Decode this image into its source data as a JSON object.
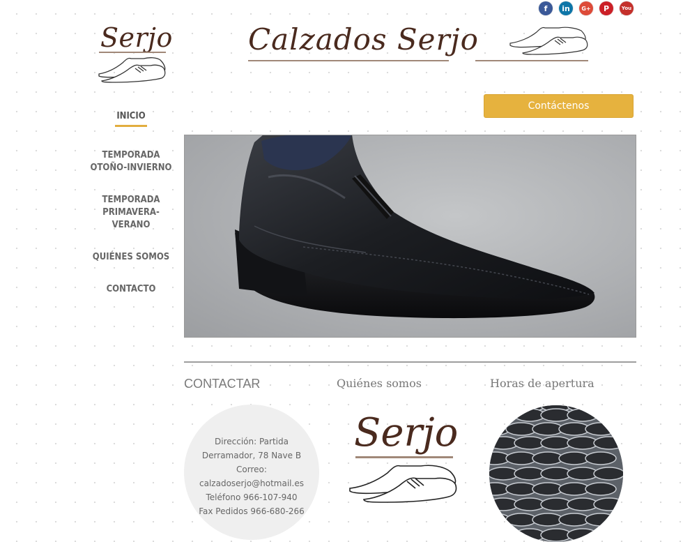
{
  "social": [
    "facebook-icon",
    "linkedin-icon",
    "google-plus-icon",
    "pinterest-icon",
    "youtube-icon"
  ],
  "social_labels": {
    "facebook": "f",
    "linkedin": "in",
    "googleplus": "G+",
    "pinterest": "P",
    "youtube": "You"
  },
  "brand": {
    "small_logo": "Serjo",
    "big_logo": "Calzados Serjo",
    "color": "#4a2a1e"
  },
  "nav": {
    "items": [
      {
        "label": "INICIO",
        "active": true
      },
      {
        "label": "TEMPORADA OTOÑO-INVIERNO"
      },
      {
        "label": "TEMPORADA PRIMAVERA-VERANO"
      },
      {
        "label": "QUIÉNES SOMOS"
      },
      {
        "label": "CONTACTO"
      }
    ],
    "l1a": "INICIO",
    "l2a": "TEMPORADA",
    "l2b": "OTOÑO-INVIERNO",
    "l3a": "TEMPORADA",
    "l3b": "PRIMAVERA-",
    "l3c": "VERANO",
    "l4a": "QUIÉNES SOMOS",
    "l5a": "CONTACTO"
  },
  "contact_button": "Contáctenos",
  "accent": "#e6b23e",
  "sections": {
    "contact_title": "CONTACTAR",
    "about_title": "Quiénes somos",
    "hours_title": "Horas de apertura"
  },
  "contact": {
    "line1": "Dirección: Partida",
    "line2": "Derramador, 78 Nave B",
    "line3": "Correo:",
    "line4": "calzadoserjo@hotmail.es",
    "line5": "Teléfono 966-107-940",
    "line6": "Fax Pedidos  966-680-266"
  },
  "about_logo": "Serjo"
}
